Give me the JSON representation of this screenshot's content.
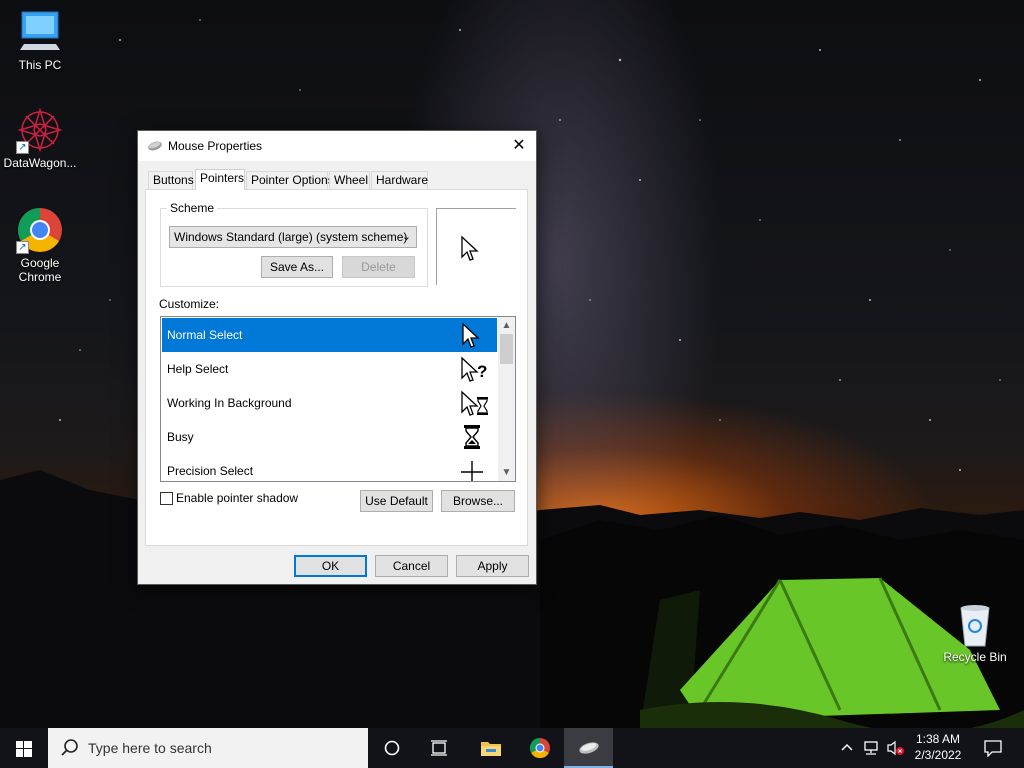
{
  "desktop": {
    "icons": [
      {
        "label": "This PC"
      },
      {
        "label": "DataWagon..."
      },
      {
        "label": "Google Chrome"
      },
      {
        "label": "Recycle Bin"
      }
    ]
  },
  "dialog": {
    "title": "Mouse Properties",
    "close_glyph": "✕",
    "tabs": [
      {
        "label": "Buttons",
        "active": false
      },
      {
        "label": "Pointers",
        "active": true
      },
      {
        "label": "Pointer Options",
        "active": false
      },
      {
        "label": "Wheel",
        "active": false
      },
      {
        "label": "Hardware",
        "active": false
      }
    ],
    "scheme": {
      "legend": "Scheme",
      "selected": "Windows Standard (large) (system scheme)",
      "save_as": "Save As...",
      "delete": "Delete"
    },
    "customize_label": "Customize:",
    "pointers": [
      {
        "label": "Normal Select",
        "icon": "arrow-cursor-icon",
        "selected": true
      },
      {
        "label": "Help Select",
        "icon": "help-cursor-icon",
        "selected": false
      },
      {
        "label": "Working In Background",
        "icon": "working-cursor-icon",
        "selected": false
      },
      {
        "label": "Busy",
        "icon": "hourglass-icon",
        "selected": false
      },
      {
        "label": "Precision Select",
        "icon": "crosshair-icon",
        "selected": false
      }
    ],
    "enable_shadow_label": "Enable pointer shadow",
    "enable_shadow_checked": false,
    "use_default": "Use Default",
    "browse": "Browse...",
    "ok": "OK",
    "cancel": "Cancel",
    "apply": "Apply"
  },
  "taskbar": {
    "search_placeholder": "Type here to search",
    "time": "1:38 AM",
    "date": "2/3/2022"
  },
  "colors": {
    "accent": "#0078d7",
    "taskbar": "#111319"
  }
}
